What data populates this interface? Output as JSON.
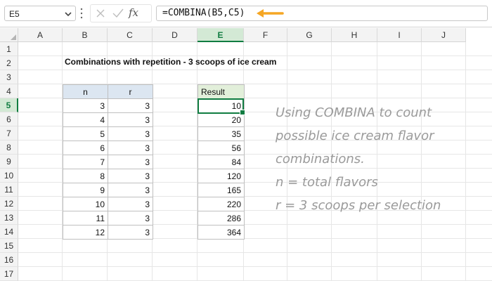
{
  "name_box": {
    "value": "E5"
  },
  "formula_bar": {
    "fx_label": "fx",
    "formula": "=COMBINA(B5,C5)"
  },
  "colors": {
    "accent_green": "#107c41",
    "arrow": "#f5a623",
    "header_blue": "#dce6f1",
    "header_green": "#e2efda",
    "note_gray": "#9a9a9a"
  },
  "columns": [
    "A",
    "B",
    "C",
    "D",
    "E",
    "F",
    "G",
    "H",
    "I",
    "J"
  ],
  "rows": [
    "1",
    "2",
    "3",
    "4",
    "5",
    "6",
    "7",
    "8",
    "9",
    "10",
    "11",
    "12",
    "13",
    "14",
    "15",
    "16",
    "17"
  ],
  "sheet": {
    "title": "Combinations with repetition - 3 scoops of ice cream",
    "table": {
      "headers": [
        "n",
        "r"
      ],
      "n": [
        "3",
        "4",
        "5",
        "6",
        "7",
        "8",
        "9",
        "10",
        "11",
        "12"
      ],
      "r": [
        "3",
        "3",
        "3",
        "3",
        "3",
        "3",
        "3",
        "3",
        "3",
        "3"
      ]
    },
    "result": {
      "header": "Result",
      "values": [
        "10",
        "20",
        "35",
        "56",
        "84",
        "120",
        "165",
        "220",
        "286",
        "364"
      ]
    },
    "note_lines": [
      "Using COMBINA to count",
      "possible ice cream flavor",
      "combinations.",
      "n = total flavors",
      "r = 3 scoops per selection"
    ]
  }
}
